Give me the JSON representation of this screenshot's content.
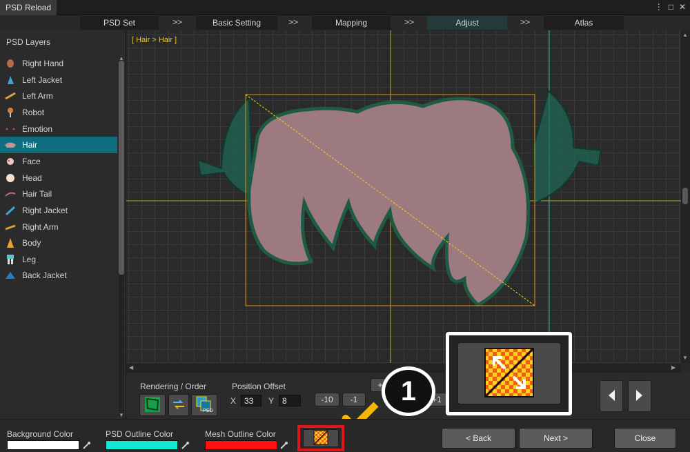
{
  "window": {
    "title": "PSD Reload"
  },
  "steps": [
    {
      "label": "PSD Set"
    },
    {
      "label": "Basic Setting"
    },
    {
      "label": "Mapping"
    },
    {
      "label": "Adjust"
    },
    {
      "label": "Atlas"
    }
  ],
  "step_separator": ">>",
  "active_step": "Adjust",
  "layers_panel": {
    "title": "PSD Layers",
    "selected": "Hair",
    "items": [
      {
        "label": "Right Hand",
        "icon": "hand-icon"
      },
      {
        "label": "Left Jacket",
        "icon": "jacket-icon"
      },
      {
        "label": "Left Arm",
        "icon": "arm-icon"
      },
      {
        "label": "Robot",
        "icon": "robot-icon"
      },
      {
        "label": "Emotion",
        "icon": "emotion-icon"
      },
      {
        "label": "Hair",
        "icon": "hair-icon"
      },
      {
        "label": "Face",
        "icon": "face-icon"
      },
      {
        "label": "Head",
        "icon": "head-icon"
      },
      {
        "label": "Hair Tail",
        "icon": "hair-tail-icon"
      },
      {
        "label": "Right Jacket",
        "icon": "jacket-icon"
      },
      {
        "label": "Right Arm",
        "icon": "arm-icon"
      },
      {
        "label": "Body",
        "icon": "body-icon"
      },
      {
        "label": "Leg",
        "icon": "leg-icon"
      },
      {
        "label": "Back Jacket",
        "icon": "back-jacket-icon"
      }
    ]
  },
  "viewport": {
    "breadcrumb": "[ Hair > Hair ]",
    "guide_color": "#d8c820",
    "bounds_color": "#e09018",
    "mesh_outline_color": "#1f5a45"
  },
  "controls": {
    "rendering_label": "Rendering / Order",
    "position_label": "Position Offset",
    "x_label": "X",
    "x_value": "33",
    "y_label": "Y",
    "y_value": "8",
    "step_minus10": "-10",
    "step_minus1": "-1",
    "step_plus1": "+1",
    "step_plus_small": "+"
  },
  "callout": {
    "number": "1",
    "color": "#f5b800"
  },
  "bottom": {
    "bg_color_label": "Background Color",
    "bg_color": "#ffffff",
    "psd_outline_label": "PSD Outline Color",
    "psd_outline_color": "#14e8d2",
    "mesh_outline_label": "Mesh Outline Color",
    "mesh_outline_color": "#ff1010",
    "highlight_color": "#e0151a",
    "back_label": "< Back",
    "next_label": "Next >",
    "close_label": "Close"
  }
}
